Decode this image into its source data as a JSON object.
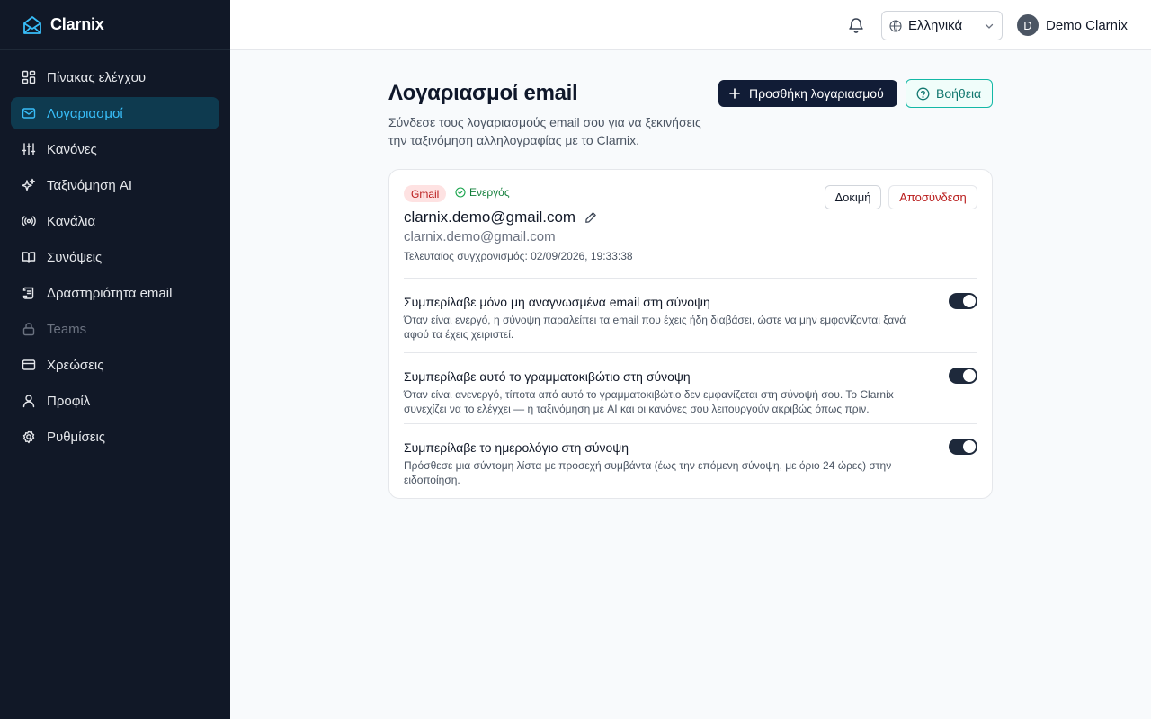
{
  "brand": {
    "name": "Clarnix",
    "color": "#38bdf8"
  },
  "sidebar": {
    "items": [
      {
        "label": "Πίνακας ελέγχου",
        "icon": "dashboard-icon"
      },
      {
        "label": "Λογαριασμοί",
        "icon": "mail-icon",
        "active": true
      },
      {
        "label": "Κανόνες",
        "icon": "sliders-icon"
      },
      {
        "label": "Ταξινόμηση AI",
        "icon": "sparkles-icon"
      },
      {
        "label": "Κανάλια",
        "icon": "broadcast-icon"
      },
      {
        "label": "Συνόψεις",
        "icon": "book-icon"
      },
      {
        "label": "Δραστηριότητα email",
        "icon": "scroll-icon"
      },
      {
        "label": "Teams",
        "icon": "lock-icon",
        "disabled": true
      },
      {
        "label": "Χρεώσεις",
        "icon": "credit-card-icon"
      },
      {
        "label": "Προφίλ",
        "icon": "user-icon"
      },
      {
        "label": "Ρυθμίσεις",
        "icon": "gear-icon"
      }
    ]
  },
  "topbar": {
    "language": "Ελληνικά",
    "user_initial": "D",
    "user_name": "Demo Clarnix"
  },
  "page": {
    "title": "Λογαριασμοί email",
    "subtitle": "Σύνδεσε τους λογαριασμούς email σου για να ξεκινήσεις την ταξινόμηση αλληλογραφίας με το Clarnix.",
    "add_button": "Προσθήκη λογαριασμού",
    "help_button": "Βοήθεια"
  },
  "account": {
    "provider": "Gmail",
    "status": "Ενεργός",
    "name": "clarnix.demo@gmail.com",
    "email": "clarnix.demo@gmail.com",
    "last_sync": "Τελευταίος συγχρονισμός: 02/09/2026, 19:33:38",
    "test_button": "Δοκιμή",
    "disconnect_button": "Αποσύνδεση",
    "settings": [
      {
        "title": "Συμπερίλαβε μόνο μη αναγνωσμένα email στη σύνοψη",
        "description": "Όταν είναι ενεργό, η σύνοψη παραλείπει τα email που έχεις ήδη διαβάσει, ώστε να μην εμφανίζονται ξανά αφού τα έχεις χειριστεί.",
        "enabled": true
      },
      {
        "title": "Συμπερίλαβε αυτό το γραμματοκιβώτιο στη σύνοψη",
        "description": "Όταν είναι ανενεργό, τίποτα από αυτό το γραμματοκιβώτιο δεν εμφανίζεται στη σύνοψή σου. Το Clarnix συνεχίζει να το ελέγχει — η ταξινόμηση με AI και οι κανόνες σου λειτουργούν ακριβώς όπως πριν.",
        "enabled": true
      },
      {
        "title": "Συμπερίλαβε το ημερολόγιο στη σύνοψη",
        "description": "Πρόσθεσε μια σύντομη λίστα με προσεχή συμβάντα (έως την επόμενη σύνοψη, με όριο 24 ώρες) στην ειδοποίηση.",
        "enabled": true
      }
    ]
  }
}
